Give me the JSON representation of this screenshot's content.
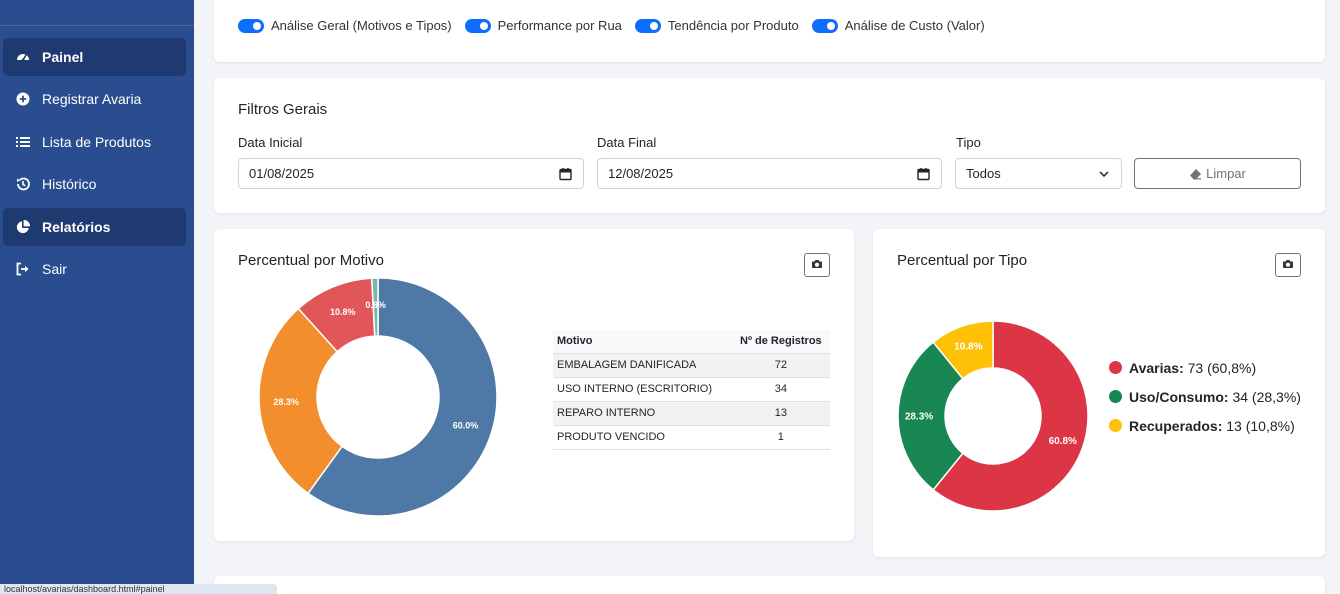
{
  "sidebar": {
    "items": [
      {
        "label": "Painel",
        "icon": "gauge-icon",
        "active": true
      },
      {
        "label": "Registrar Avaria",
        "icon": "plus-circle-icon",
        "active": false
      },
      {
        "label": "Lista de Produtos",
        "icon": "list-icon",
        "active": false
      },
      {
        "label": "Histórico",
        "icon": "history-icon",
        "active": false
      },
      {
        "label": "Relatórios",
        "icon": "pie-chart-icon",
        "active": true
      },
      {
        "label": "Sair",
        "icon": "logout-icon",
        "active": false
      }
    ]
  },
  "toggles": [
    {
      "label": "Análise Geral (Motivos e Tipos)",
      "on": true
    },
    {
      "label": "Performance por Rua",
      "on": true
    },
    {
      "label": "Tendência por Produto",
      "on": true
    },
    {
      "label": "Análise de Custo (Valor)",
      "on": true
    }
  ],
  "filters": {
    "title": "Filtros Gerais",
    "start_label": "Data Inicial",
    "start_value": "01/08/2025",
    "end_label": "Data Final",
    "end_value": "12/08/2025",
    "type_label": "Tipo",
    "type_value": "Todos",
    "clear_label": "Limpar"
  },
  "motivo_card": {
    "title": "Percentual por Motivo",
    "table_headers": [
      "Motivo",
      "Nº de Registros"
    ],
    "table_rows": [
      [
        "EMBALAGEM DANIFICADA",
        "72"
      ],
      [
        "USO INTERNO (ESCRITORIO)",
        "34"
      ],
      [
        "REPARO INTERNO",
        "13"
      ],
      [
        "PRODUTO VENCIDO",
        "1"
      ]
    ]
  },
  "tipo_card": {
    "title": "Percentual por Tipo",
    "legend": [
      {
        "name": "Avarias:",
        "detail": "73 (60,8%)",
        "color": "#dc3545"
      },
      {
        "name": "Uso/Consumo:",
        "detail": "34 (28,3%)",
        "color": "#198754"
      },
      {
        "name": "Recuperados:",
        "detail": "13 (10,8%)",
        "color": "#ffc107"
      }
    ]
  },
  "status_bar": "localhost/avarias/dashboard.html#painel",
  "chart_data": [
    {
      "type": "pie",
      "title": "Percentual por Motivo",
      "categories": [
        "EMBALAGEM DANIFICADA",
        "USO INTERNO (ESCRITORIO)",
        "REPARO INTERNO",
        "PRODUTO VENCIDO"
      ],
      "values": [
        72,
        34,
        13,
        1
      ],
      "labels": [
        "60.0%",
        "28.3%",
        "10.8%",
        "0.8%"
      ],
      "colors": [
        "#4e78a6",
        "#f28e2b",
        "#e15759",
        "#76b7b2"
      ]
    },
    {
      "type": "pie",
      "title": "Percentual por Tipo",
      "categories": [
        "Avarias",
        "Uso/Consumo",
        "Recuperados"
      ],
      "values": [
        73,
        34,
        13
      ],
      "labels": [
        "60.8%",
        "28.3%",
        "10.8%"
      ],
      "colors": [
        "#dc3545",
        "#198754",
        "#ffc107"
      ]
    }
  ]
}
